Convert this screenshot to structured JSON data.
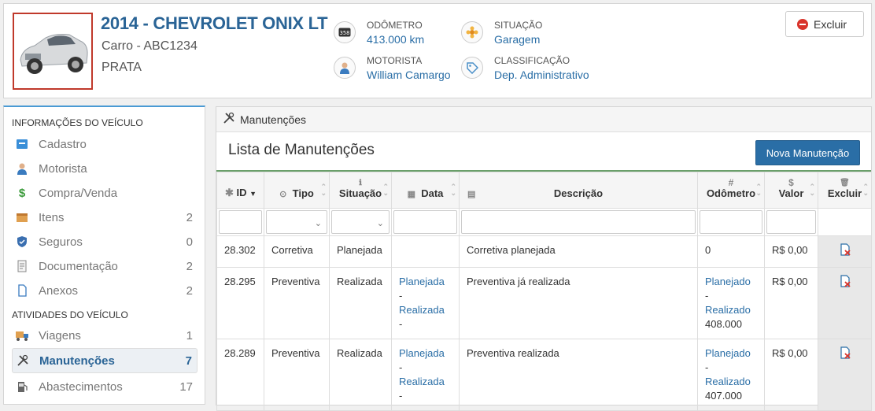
{
  "vehicle": {
    "title": "2014 - CHEVROLET ONIX LT",
    "subtitle": "Carro - ABC1234",
    "color": "PRATA"
  },
  "info": {
    "odometro_label": "ODÔMETRO",
    "odometro_value": "413.000 km",
    "situacao_label": "SITUAÇÃO",
    "situacao_value": "Garagem",
    "motorista_label": "MOTORISTA",
    "motorista_value": "William Camargo",
    "classificacao_label": "CLASSIFICAÇÃO",
    "classificacao_value": "Dep. Administrativo"
  },
  "header_actions": {
    "excluir": "Excluir"
  },
  "sidebar": {
    "section1": "INFORMAÇÕES DO VEÍCULO",
    "section2": "ATIVIDADES DO VEÍCULO",
    "items": [
      {
        "label": "Cadastro",
        "count": ""
      },
      {
        "label": "Motorista",
        "count": ""
      },
      {
        "label": "Compra/Venda",
        "count": ""
      },
      {
        "label": "Itens",
        "count": "2"
      },
      {
        "label": "Seguros",
        "count": "0"
      },
      {
        "label": "Documentação",
        "count": "2"
      },
      {
        "label": "Anexos",
        "count": "2"
      },
      {
        "label": "Viagens",
        "count": "1"
      },
      {
        "label": "Manutenções",
        "count": "7"
      },
      {
        "label": "Abastecimentos",
        "count": "17"
      }
    ]
  },
  "panel": {
    "tab": "Manutenções",
    "list_title": "Lista de Manutenções",
    "new_button": "Nova Manutenção"
  },
  "table": {
    "headers": {
      "id": "ID",
      "tipo": "Tipo",
      "situacao": "Situação",
      "data": "Data",
      "descricao": "Descrição",
      "odometro": "Odômetro",
      "valor": "Valor",
      "excluir": "Excluir"
    },
    "rows": [
      {
        "id": "28.302",
        "tipo": "Corretiva",
        "situacao": "Planejada",
        "data_planejada": "",
        "data_sep1": "",
        "data_realizada": "",
        "data_sep2": "",
        "descricao": "Corretiva planejada",
        "odo_plain": "0",
        "odo_planejado": "",
        "odo_sep": "",
        "odo_realizado": "",
        "odo_value": "",
        "valor": "R$ 0,00"
      },
      {
        "id": "28.295",
        "tipo": "Preventiva",
        "situacao": "Realizada",
        "data_planejada": "Planejada",
        "data_sep1": "-",
        "data_realizada": "Realizada",
        "data_sep2": "-",
        "descricao": "Preventiva já realizada",
        "odo_plain": "",
        "odo_planejado": "Planejado",
        "odo_sep": "-",
        "odo_realizado": "Realizado",
        "odo_value": "408.000",
        "valor": "R$ 0,00"
      },
      {
        "id": "28.289",
        "tipo": "Preventiva",
        "situacao": "Realizada",
        "data_planejada": "Planejada",
        "data_sep1": "-",
        "data_realizada": "Realizada",
        "data_sep2": "-",
        "descricao": "Preventiva realizada",
        "odo_plain": "",
        "odo_planejado": "Planejado",
        "odo_sep": "-",
        "odo_realizado": "Realizado",
        "odo_value": "407.000",
        "valor": "R$ 0,00"
      }
    ]
  },
  "colors": {
    "accent": "#2a6ea6",
    "danger": "#d9342b",
    "header_border": "#6a9f6a"
  }
}
